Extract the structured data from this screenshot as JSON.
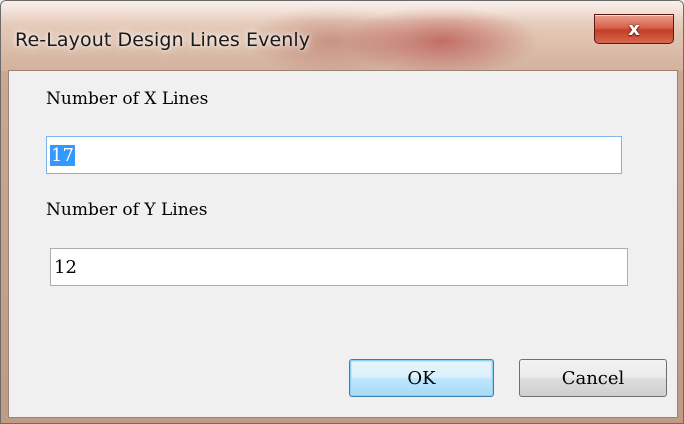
{
  "window": {
    "title": "Re-Layout Design Lines Evenly",
    "close_glyph": "x",
    "close_icon": "close-icon"
  },
  "form": {
    "x_lines_label": "Number of X Lines",
    "x_lines_value": "17",
    "y_lines_label": "Number of Y Lines",
    "y_lines_value": "12"
  },
  "buttons": {
    "ok_label": "OK",
    "cancel_label": "Cancel"
  },
  "colors": {
    "selection": "#3399ff",
    "close_button": "#c7432b",
    "focus_border": "#7eb4ea"
  }
}
